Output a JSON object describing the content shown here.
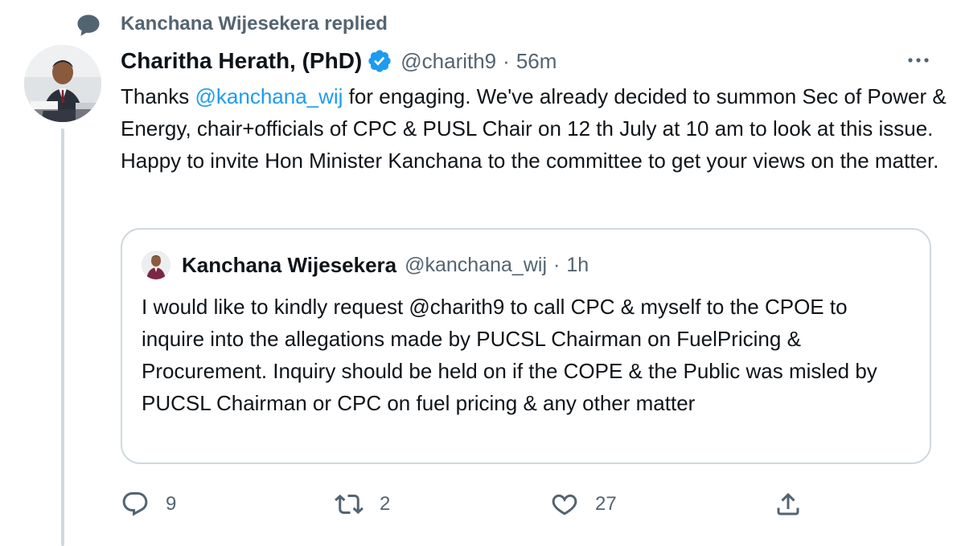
{
  "social_context": {
    "text": "Kanchana Wijesekera replied",
    "icon": "reply-bubble-icon"
  },
  "tweet": {
    "author_name": "Charitha Herath, (PhD)",
    "verified": true,
    "handle": "@charith9",
    "separator": "·",
    "time": "56m",
    "text_parts": {
      "p1": "Thanks ",
      "mention": "@kanchana_wij",
      "p2": " for engaging. We've already decided to summon Sec of Power & Energy, chair+officials of CPC & PUSL Chair on 12 th July at 10 am to look at this issue. Happy to invite Hon Minister Kanchana to the committee to get your views on the matter."
    }
  },
  "quoted_tweet": {
    "author_name": "Kanchana Wijesekera",
    "handle": "@kanchana_wij",
    "separator": "·",
    "time": "1h",
    "text": "I would like to kindly request @charith9 to call CPC & myself to the CPOE to inquire into the allegations made by PUCSL Chairman on FuelPricing & Procurement. Inquiry should be held on if the COPE & the Public was misled by PUCSL Chairman or CPC on fuel pricing & any other matter"
  },
  "actions": {
    "replies": "9",
    "retweets": "2",
    "likes": "27"
  },
  "colors": {
    "accent": "#1d9bf0",
    "secondary_text": "#536471",
    "border": "#cfd9de"
  }
}
